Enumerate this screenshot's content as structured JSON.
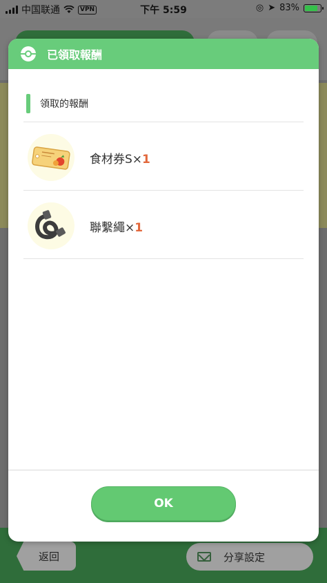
{
  "status_bar": {
    "carrier": "中国联通",
    "vpn": "VPN",
    "time": "下午 5:59",
    "battery_percent": "83%",
    "battery_level": 0.83
  },
  "background": {
    "back_label": "返回",
    "share_label": "分享設定"
  },
  "modal": {
    "title": "已領取報酬",
    "section_title": "領取的報酬",
    "items": [
      {
        "name": "食材券S",
        "times": "×",
        "count": "1",
        "icon": "ingredient-ticket-icon"
      },
      {
        "name": "聯繫繩",
        "times": "×",
        "count": "1",
        "icon": "link-cable-icon"
      }
    ],
    "ok_label": "OK"
  },
  "colors": {
    "accent_green": "#68cc7b",
    "count_orange": "#e2683c",
    "item_circle": "#fdfbe4"
  }
}
